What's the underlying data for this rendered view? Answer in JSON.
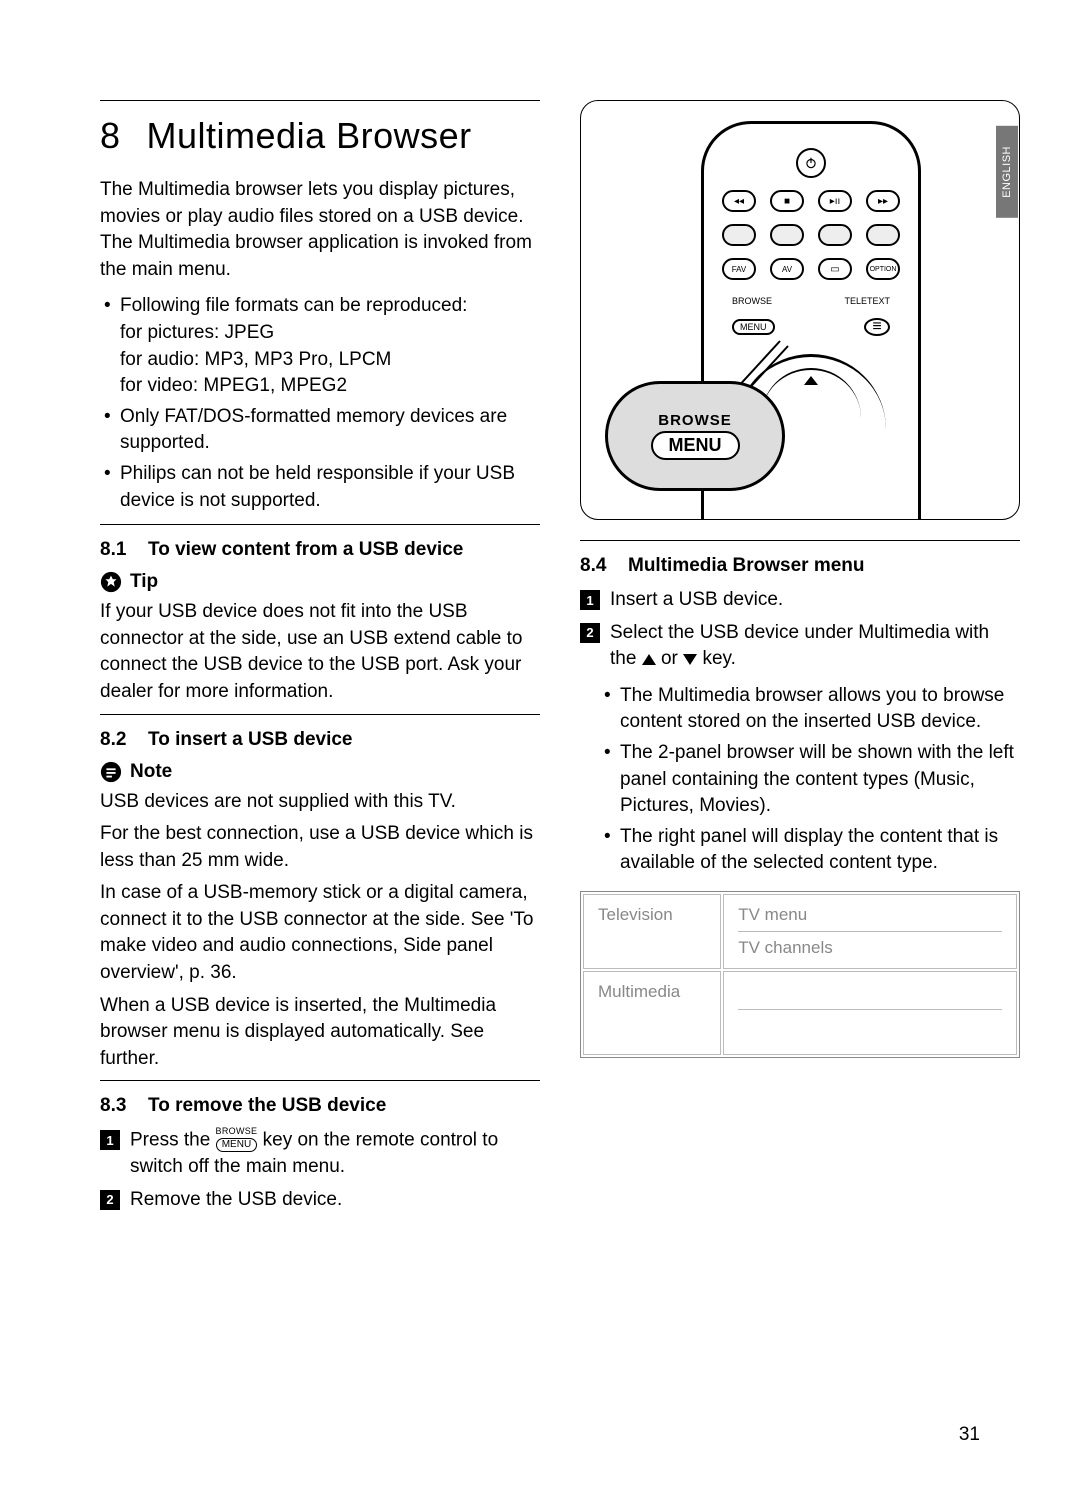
{
  "lang_tab": "ENGLISH",
  "page_number": "31",
  "h1": {
    "num": "8",
    "title": "Multimedia Browser"
  },
  "intro": "The Multimedia browser lets you display pictures, movies or play audio files stored on a USB device. The Multimedia browser application is invoked from the main menu.",
  "formats": {
    "lead": "Following file formats can be reproduced:",
    "pic": "for pictures: JPEG",
    "aud": "for audio: MP3, MP3 Pro, LPCM",
    "vid": "for video: MPEG1, MPEG2"
  },
  "only_fat": "Only FAT/DOS-formatted memory devices are supported.",
  "philips": "Philips can not be held responsible if your USB device is not supported.",
  "s81": {
    "num": "8.1",
    "title": "To view content from a USB device"
  },
  "tip": {
    "label": "Tip",
    "text": "If your USB device does not fit into the USB connector at the side, use an USB extend cable to connect the USB device to the USB port. Ask your dealer for more information."
  },
  "s82": {
    "num": "8.2",
    "title": "To insert a USB device"
  },
  "note": {
    "label": "Note",
    "p1": "USB devices are not supplied with this TV.",
    "p2": "For the best connection, use a USB device which is less than 25 mm wide.",
    "p3": "In case of a USB-memory stick or a digital camera, connect it to the USB connector at the side. See 'To make video and audio connections, Side panel overview', p. 36.",
    "p4": "When a USB device is inserted, the Multimedia browser menu is displayed automatically. See further."
  },
  "s83": {
    "num": "8.3",
    "title": "To remove the USB device"
  },
  "s83_steps": {
    "1_a": "Press the ",
    "1_b": " key on the remote control to switch off the main menu.",
    "2": "Remove the USB device."
  },
  "remote": {
    "fav": "FAV",
    "av": "AV",
    "option": "OPTION",
    "browse": "BROWSE",
    "menu": "MENU",
    "teletext": "TELETEXT",
    "callout_browse": "BROWSE",
    "callout_menu": "MENU"
  },
  "s84": {
    "num": "8.4",
    "title": "Multimedia Browser menu"
  },
  "s84_steps": {
    "1": "Insert a USB device.",
    "2a": "Select the USB device under Multimedia with the ",
    "2b": " or ",
    "2c": " key."
  },
  "s84_bullets": {
    "a": "The Multimedia browser allows you to browse content stored on the inserted USB device.",
    "b": "The 2-panel browser will be shown with the left panel containing the content types (Music, Pictures, Movies).",
    "c": "The right panel will display the content that is available of the selected content type."
  },
  "menu_table": {
    "tv": "Television",
    "tv_menu": "TV menu",
    "tv_channels": "TV channels",
    "mm": "Multimedia"
  },
  "menu_key": {
    "browse": "BROWSE",
    "menu": "MENU"
  }
}
